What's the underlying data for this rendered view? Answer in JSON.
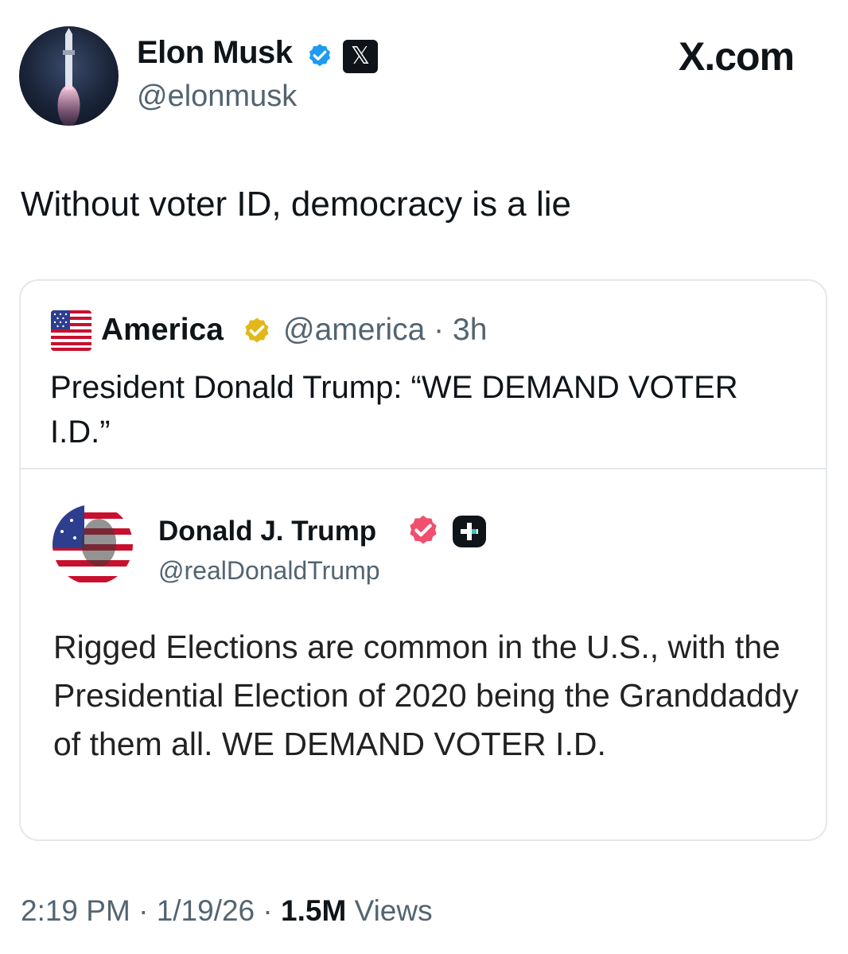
{
  "post": {
    "author_name": "Elon Musk",
    "author_handle": "@elonmusk",
    "site_brand": "X.com",
    "x_badge": "𝕏",
    "text": "Without voter ID, democracy is a lie",
    "time": "2:19 PM",
    "date": "1/19/26",
    "views_count": "1.5M",
    "views_label": "Views",
    "separator": "·"
  },
  "quote": {
    "name": "America",
    "handle": "@america",
    "age": "3h",
    "text": "President Donald Trump: “WE DEMAND VOTER I.D.”"
  },
  "embedded": {
    "name": "Donald J. Trump",
    "handle": "@realDonaldTrump",
    "text": "Rigged Elections are common in the U.S., with the Presidential Election of 2020 being the Granddaddy of them all. WE DEMAND VOTER I.D."
  },
  "colors": {
    "verified_blue": "#1d9bf0",
    "verified_gold": "#e2b719",
    "badge_pink": "#f0506e",
    "muted_text": "#536471",
    "border": "#e4e8ec"
  },
  "icons": [
    "verified-badge-icon",
    "x-logo-icon",
    "us-flag-icon",
    "gold-verified-icon",
    "pink-verified-icon",
    "plus-badge-icon"
  ]
}
